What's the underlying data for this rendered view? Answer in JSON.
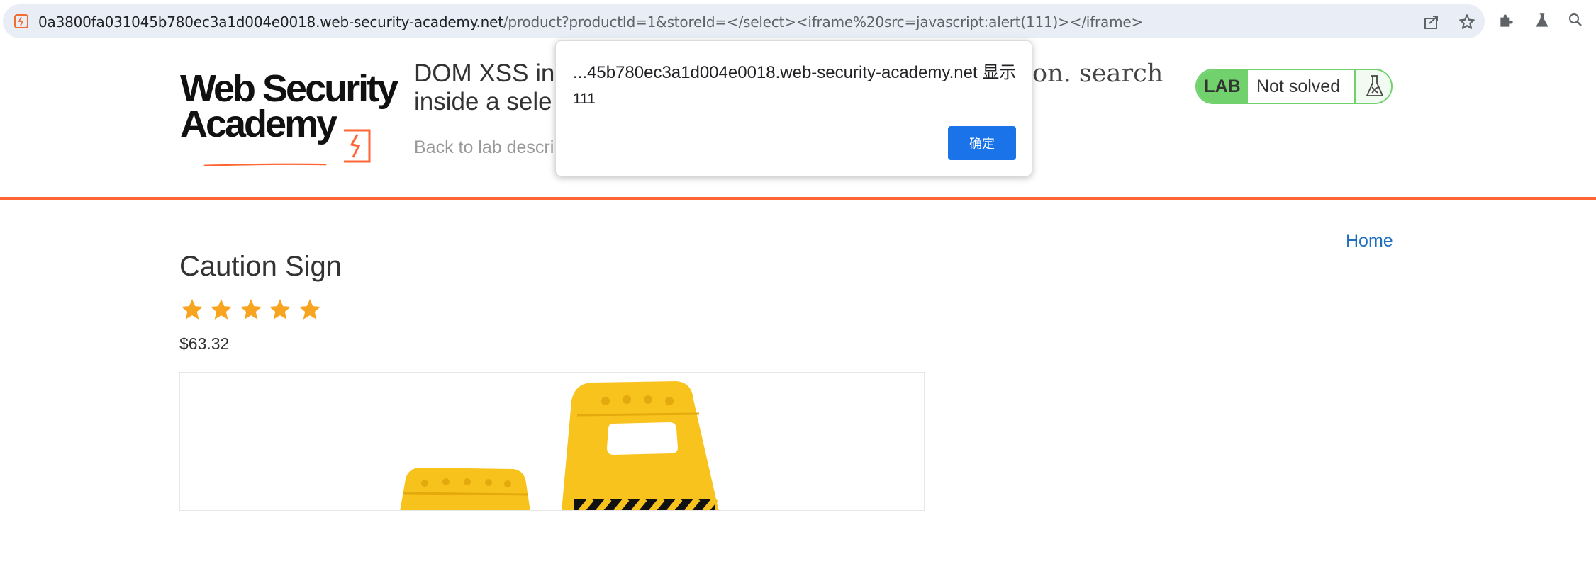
{
  "browser": {
    "url_host": "0a3800fa031045b780ec3a1d004e0018.web-security-academy.net",
    "url_path": "/product?productId=1&storeId=</select><iframe%20src=javascript:alert(111)></iframe>",
    "icons": [
      "site-favicon-icon",
      "share-icon",
      "star-bookmark-icon",
      "extensions-puzzle-icon",
      "flask-extension-icon",
      "search-icon"
    ]
  },
  "header": {
    "logo_line1": "Web Security",
    "logo_line2": "Academy",
    "lab_title_part1": "DOM XSS in",
    "lab_title_part2": "inside a sele",
    "lab_title_tail": "on. search",
    "back_link": "Back to lab descrip",
    "badge_lab": "LAB",
    "badge_status": "Not solved"
  },
  "dialog": {
    "title": "...45b780ec3a1d004e0018.web-security-academy.net 显示",
    "message": "111",
    "ok_label": "确定"
  },
  "main": {
    "home_link": "Home",
    "product_title": "Caution Sign",
    "rating": 5,
    "rating_max": 5,
    "price": "$63.32"
  },
  "colors": {
    "accent_orange": "#ff6633",
    "lab_green": "#70d16d",
    "link_blue": "#1f6fc0",
    "star_orange": "#f7a520",
    "dialog_button": "#1a73e8"
  }
}
